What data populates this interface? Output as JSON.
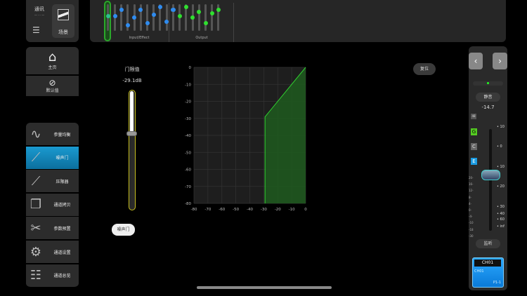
{
  "top_left": {
    "comm_label": "通讯",
    "comm_status": "— ··· —",
    "scene_label": "场景"
  },
  "mixer_strip": {
    "group1_label": "Input/Effect",
    "group2_label": "Output",
    "input_levels": [
      0.55,
      0.78,
      0.2,
      0.5,
      0.8,
      0.3,
      0.6,
      0.9,
      0.35,
      0.78
    ],
    "output_levels": [
      0.78,
      0.55,
      0.9,
      0.5,
      0.72,
      0.3,
      0.65,
      0.8
    ],
    "input_color": "#2f8cf0",
    "output_color": "#2fe02f"
  },
  "nav": {
    "home": "主页",
    "default": "默认值",
    "items": [
      {
        "label": "参量均衡",
        "icon": "eq-curve-icon"
      },
      {
        "label": "噪声门",
        "icon": "gate-curve-icon",
        "active": true
      },
      {
        "label": "压限器",
        "icon": "compressor-curve-icon"
      },
      {
        "label": "通道拷贝",
        "icon": "copy-icon"
      },
      {
        "label": "参数预置",
        "icon": "preset-folder-icon"
      },
      {
        "label": "通道设置",
        "icon": "gears-icon"
      },
      {
        "label": "通道总览",
        "icon": "overview-grid-icon"
      }
    ]
  },
  "gate": {
    "title": "门限值",
    "value_text": "-29.1dB",
    "threshold_db": -29.1,
    "range": [
      -80,
      0
    ],
    "toggle_label": "噪声门"
  },
  "reset_label": "复位",
  "chart_data": {
    "type": "line",
    "title": "",
    "xlabel": "",
    "ylabel": "",
    "xlim": [
      -80,
      0
    ],
    "ylim": [
      -80,
      0
    ],
    "x_ticks": [
      "-80",
      "-70",
      "-60",
      "-50",
      "-40",
      "-30",
      "-20",
      "-10",
      "0"
    ],
    "y_ticks": [
      "0",
      "-10",
      "-20",
      "-30",
      "-40",
      "-50",
      "-60",
      "-70",
      "-80"
    ],
    "series": [
      {
        "name": "gate",
        "points": [
          [
            -29.1,
            -80
          ],
          [
            -29.1,
            -29.1
          ],
          [
            0,
            0
          ]
        ],
        "color": "#2fd02f"
      }
    ],
    "grid": true
  },
  "channel": {
    "mute_label": "静音",
    "fader_value": "-14.7",
    "fader_level": 0.55,
    "badge_48": "48",
    "badge_g": "G",
    "badge_c": "C",
    "badge_e": "E",
    "fader_scale": [
      "10",
      "0",
      "10",
      "20",
      "30",
      "40",
      "60",
      "inf"
    ],
    "meter_scale": [
      "20-",
      "16-",
      "12-",
      "8-",
      "4-",
      "0-",
      "-4-",
      "-10",
      "-18",
      "-30"
    ],
    "solo_label": "监听",
    "ch_name": "CH01",
    "ch_sub": "CH01",
    "ch_port": "P1-1"
  }
}
